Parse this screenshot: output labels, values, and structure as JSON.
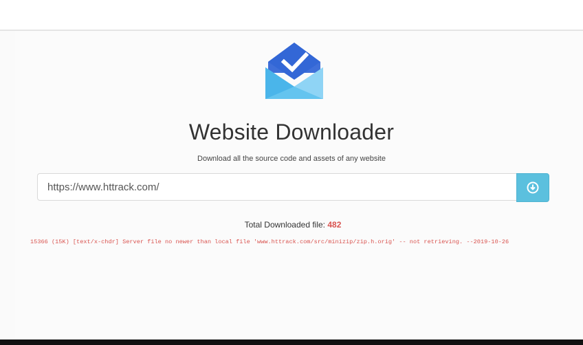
{
  "header": {
    "title": "Website Downloader",
    "subtitle": "Download all the source code and assets of any website",
    "logo_icon": "inbox-check-icon"
  },
  "search": {
    "value": "https://www.httrack.com/",
    "button_icon": "download-circle-icon"
  },
  "status": {
    "total_label": "Total Downloaded file: ",
    "total_count": "482",
    "log_text": "15366 (15K) [text/x-chdr] Server file no newer than local file 'www.httrack.com/src/minizip/zip.h.orig' -- not retrieving. --2019-10-26"
  },
  "colors": {
    "button": "#5bc0de",
    "count": "#d9534f",
    "log": "#d9534f",
    "logo_dark": "#3367d6",
    "logo_light": "#8dd3f5"
  }
}
